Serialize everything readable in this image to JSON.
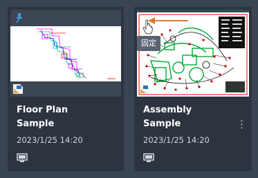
{
  "cards": [
    {
      "title": "Floor Plan Sample",
      "date": "2023/1/25 14:20",
      "pinned": true
    },
    {
      "title": "Assembly Sample",
      "date": "2023/1/25 14:20",
      "tooltip": "固定",
      "more_label": "⋮"
    }
  ],
  "colors": {
    "background": "#3b4453",
    "card": "#2c3440",
    "pin": "#3b9bd9",
    "annotation_arrow": "#e07a2e"
  }
}
